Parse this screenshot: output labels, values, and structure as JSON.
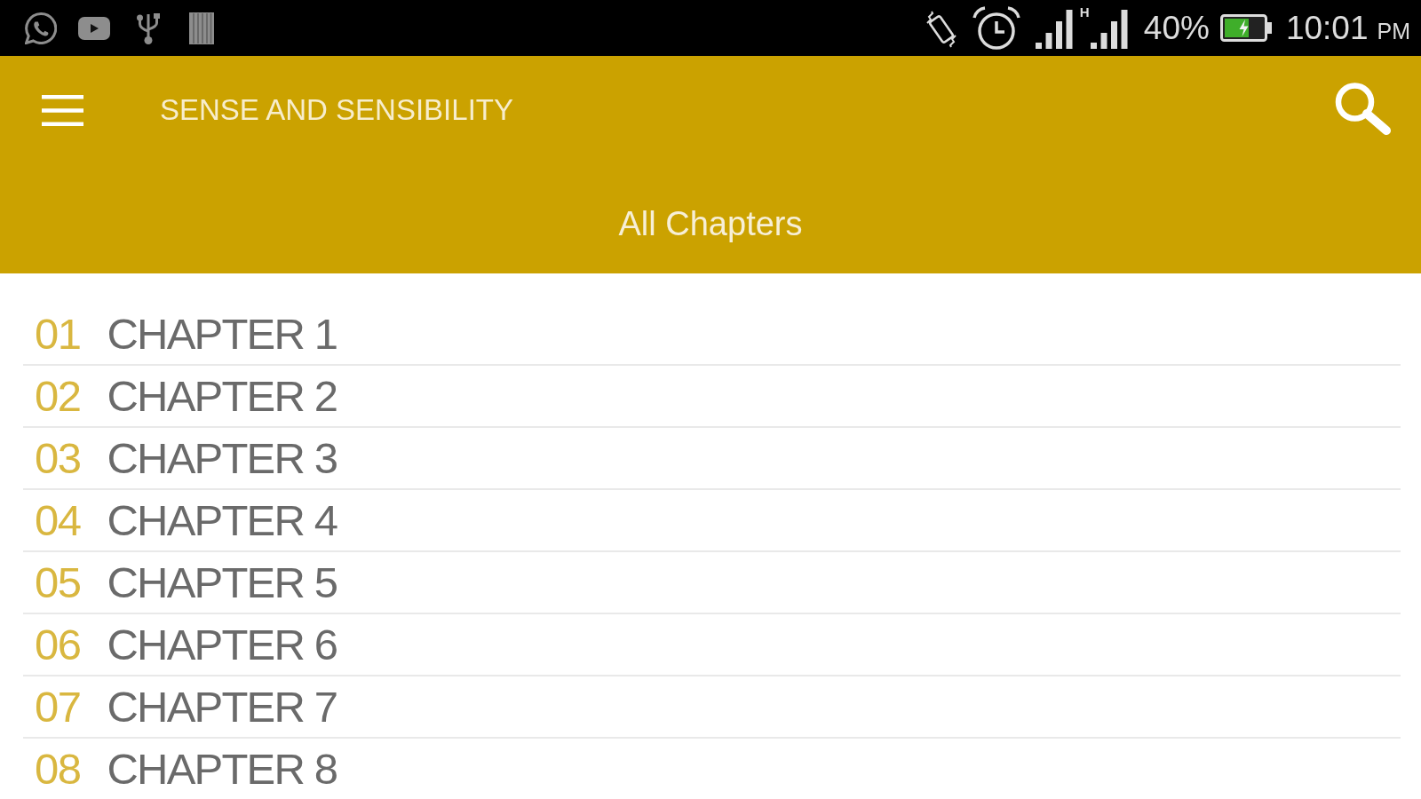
{
  "status_bar": {
    "network_type": "H",
    "battery": "40%",
    "time": "10:01",
    "meridiem": "PM"
  },
  "app_bar": {
    "title": "SENSE AND SENSIBILITY",
    "subtitle": "All Chapters"
  },
  "chapters": [
    {
      "number": "01",
      "title": "CHAPTER 1"
    },
    {
      "number": "02",
      "title": "CHAPTER 2"
    },
    {
      "number": "03",
      "title": "CHAPTER 3"
    },
    {
      "number": "04",
      "title": "CHAPTER 4"
    },
    {
      "number": "05",
      "title": "CHAPTER 5"
    },
    {
      "number": "06",
      "title": "CHAPTER 6"
    },
    {
      "number": "07",
      "title": "CHAPTER 7"
    },
    {
      "number": "08",
      "title": "CHAPTER 8"
    }
  ]
}
